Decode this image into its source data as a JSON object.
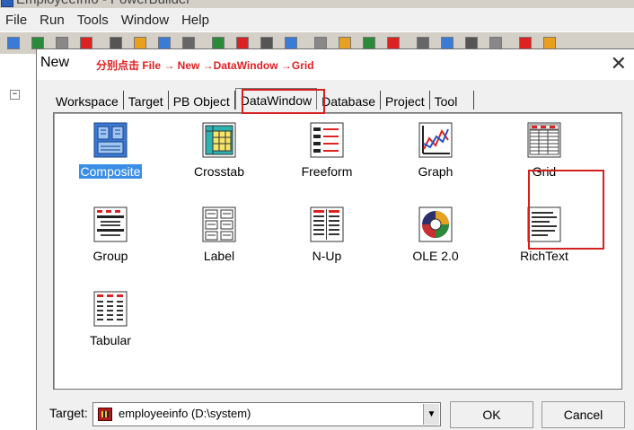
{
  "app": {
    "title": "EmployeeInfo - PowerBuilder"
  },
  "menubar": {
    "items": [
      "File",
      "Run",
      "Tools",
      "Window",
      "Help"
    ]
  },
  "dialog": {
    "title": "New",
    "annotation": "分别点击 File → New →DataWindow →Grid",
    "tabs": [
      "Workspace",
      "Target",
      "PB Object",
      "DataWindow",
      "Database",
      "Project",
      "Tool"
    ],
    "active_tab": "DataWindow",
    "items": [
      {
        "label": "Composite",
        "icon": "composite-icon",
        "selected": true
      },
      {
        "label": "Crosstab",
        "icon": "crosstab-icon"
      },
      {
        "label": "Freeform",
        "icon": "freeform-icon"
      },
      {
        "label": "Graph",
        "icon": "graph-icon"
      },
      {
        "label": "Grid",
        "icon": "grid-icon"
      },
      {
        "label": "Group",
        "icon": "group-icon"
      },
      {
        "label": "Label",
        "icon": "label-icon"
      },
      {
        "label": "N-Up",
        "icon": "nup-icon"
      },
      {
        "label": "OLE 2.0",
        "icon": "ole-icon"
      },
      {
        "label": "RichText",
        "icon": "richtext-icon"
      },
      {
        "label": "Tabular",
        "icon": "tabular-icon"
      }
    ],
    "target_label": "Target:",
    "target_value": "employeeinfo (D:\\system)",
    "ok_label": "OK",
    "cancel_label": "Cancel"
  }
}
